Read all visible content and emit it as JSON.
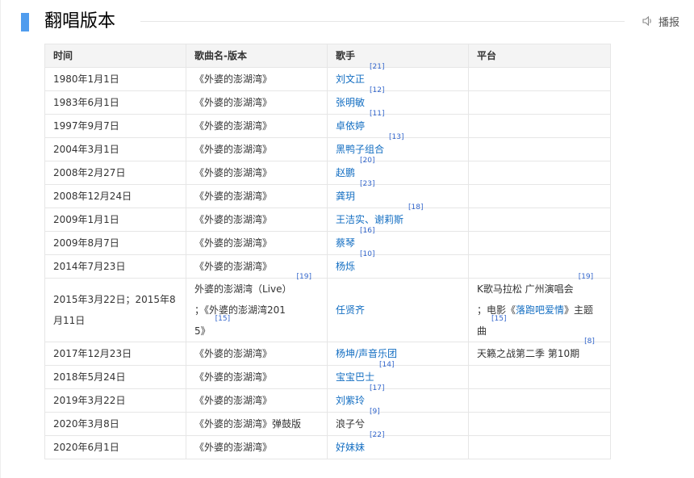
{
  "section": {
    "title": "翻唱版本",
    "play_label": "播报"
  },
  "table": {
    "headers": [
      "时间",
      "歌曲名-版本",
      "歌手",
      "平台"
    ],
    "rows": [
      {
        "date": "1980年1月1日",
        "song": "《外婆的澎湖湾》",
        "singer": "刘文正",
        "singer_ref": "[21]",
        "platform": ""
      },
      {
        "date": "1983年6月1日",
        "song": "《外婆的澎湖湾》",
        "singer": "张明敏",
        "singer_ref": "[12]",
        "platform": ""
      },
      {
        "date": "1997年9月7日",
        "song": "《外婆的澎湖湾》",
        "singer": "卓依婷",
        "singer_ref": "[11]",
        "platform": ""
      },
      {
        "date": "2004年3月1日",
        "song": "《外婆的澎湖湾》",
        "singer": "黑鸭子组合",
        "singer_ref": "[13]",
        "platform": ""
      },
      {
        "date": "2008年2月27日",
        "song": "《外婆的澎湖湾》",
        "singer": "赵鹏",
        "singer_ref": "[20]",
        "platform": ""
      },
      {
        "date": "2008年12月24日",
        "song": "《外婆的澎湖湾》",
        "singer": "龚玥",
        "singer_ref": "[23]",
        "platform": ""
      },
      {
        "date": "2009年1月1日",
        "song": "《外婆的澎湖湾》",
        "singer": "王洁实、谢莉斯",
        "singer_ref": "[18]",
        "platform": ""
      },
      {
        "date": "2009年8月7日",
        "song": "《外婆的澎湖湾》",
        "singer": "蔡琴",
        "singer_ref": "[16]",
        "platform": ""
      },
      {
        "date": "2014年7月23日",
        "song": "《外婆的澎湖湾》",
        "singer": "杨烁",
        "singer_ref": "[10]",
        "platform": ""
      },
      {
        "date": "2015年3月22日；2015年8月11日",
        "song_line1": "外婆的澎湖湾（Live）",
        "song_ref1": "[19]",
        "song_line2": "；《外婆的澎湖湾201",
        "song_line3": "5》",
        "song_ref2": "[15]",
        "singer": "任贤齐",
        "platform_line1": "K歌马拉松 广州演唱会",
        "platform_ref1": "[19]",
        "platform_line2_pre": "；电影《",
        "platform_line2_link": "落跑吧爱情",
        "platform_line2_post": "》主题",
        "platform_line3": "曲",
        "platform_ref2": "[15]"
      },
      {
        "date": "2017年12月23日",
        "song": "《外婆的澎湖湾》",
        "singer": "杨坤/声音乐团",
        "singer_ref": "",
        "platform": "天籁之战第二季 第10期",
        "platform_ref": "[8]"
      },
      {
        "date": "2018年5月24日",
        "song": "《外婆的澎湖湾》",
        "singer": "宝宝巴士",
        "singer_ref": "[14]",
        "platform": ""
      },
      {
        "date": "2019年3月22日",
        "song": "《外婆的澎湖湾》",
        "singer": "刘紫玲",
        "singer_ref": "[17]",
        "platform": ""
      },
      {
        "date": "2020年3月8日",
        "song": "《外婆的澎湖湾》弹鼓版",
        "singer": "浪子兮",
        "singer_ref": "[9]",
        "platform": "",
        "singer_plain": true
      },
      {
        "date": "2020年6月1日",
        "song": "《外婆的澎湖湾》",
        "singer": "好妹妹",
        "singer_ref": "[22]",
        "platform": ""
      }
    ]
  },
  "colors": {
    "accent": "#4f9cee",
    "link": "#136ec2",
    "header_bg": "#f4f4f4",
    "border": "#e6e6e6"
  },
  "icons": {
    "play": "speaker-icon"
  }
}
